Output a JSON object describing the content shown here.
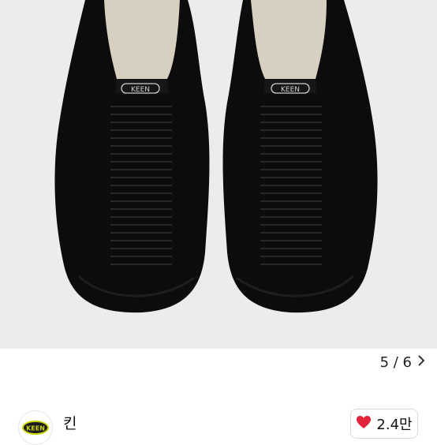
{
  "gallery": {
    "pager_text": "5 / 6",
    "next_icon": "chevron-right-icon",
    "image_subject": "black KEEN sneakers, top view",
    "insole_print": "KEEN"
  },
  "brand": {
    "logo_text": "KEEN",
    "name": "킨",
    "accent_color": "#c8d400"
  },
  "like": {
    "icon": "heart-icon",
    "count": "2.4만",
    "heart_color": "#e5243b"
  }
}
